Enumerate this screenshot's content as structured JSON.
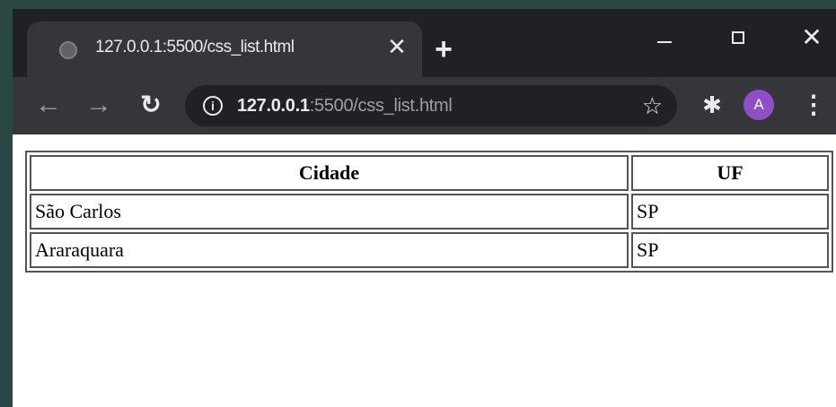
{
  "browser": {
    "tab": {
      "title": "127.0.0.1:5500/css_list.html",
      "close_icon": "close-icon",
      "favicon": "globe-icon"
    },
    "new_tab_label": "+",
    "window_controls": {
      "minimize": "minimize-icon",
      "maximize": "maximize-icon",
      "close": "close-icon"
    },
    "toolbar": {
      "back_icon": "arrow-left-icon",
      "forward_icon": "arrow-right-icon",
      "reload_icon": "reload-icon",
      "url_host": "127.0.0.1",
      "url_rest": ":5500/css_list.html",
      "bookmark_icon": "star-icon",
      "extensions_icon": "puzzle-icon",
      "profile_initial": "A",
      "menu_icon": "kebab-menu-icon"
    }
  },
  "page": {
    "table": {
      "headers": [
        "Cidade",
        "UF"
      ],
      "rows": [
        [
          "São Carlos",
          "SP"
        ],
        [
          "Araraquara",
          "SP"
        ]
      ]
    }
  },
  "colors": {
    "background": "#2b4744",
    "tabstrip": "#202124",
    "toolbar": "#35363a",
    "avatar": "#8e4ec6"
  }
}
